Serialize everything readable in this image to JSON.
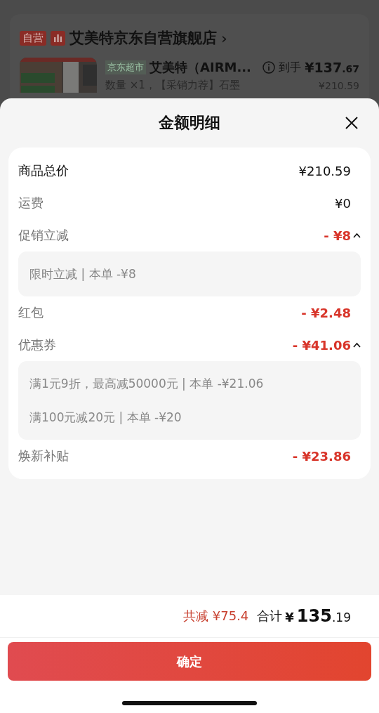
{
  "background_page": {
    "store": {
      "badge": "自营",
      "name": "艾美特京东自营旗舰店",
      "chevron": "›"
    },
    "product": {
      "channel_tag": "京东超市",
      "title": "艾美特（AIRM...",
      "price_label": "到手",
      "price_main": "¥137",
      "price_fraction": ".67",
      "spec": "数量 ×1，【采销力荐】石墨",
      "original_price": "¥210.59"
    }
  },
  "sheet": {
    "title": "金额明细",
    "rows": [
      {
        "kind": "total",
        "label": "商品总价",
        "value": "¥210.59"
      },
      {
        "kind": "plain",
        "label": "运费",
        "value": "¥0"
      },
      {
        "kind": "discount",
        "label": "促销立减",
        "value": "- ¥8",
        "expanded": true,
        "details": [
          "限时立减 | 本单 -¥8"
        ]
      },
      {
        "kind": "discount",
        "label": "红包",
        "value": "- ¥2.48"
      },
      {
        "kind": "discount",
        "label": "优惠券",
        "value": "- ¥41.06",
        "expanded": true,
        "details": [
          "满1元9折，最高减50000元 | 本单 -¥21.06",
          "满100元减20元 | 本单 -¥20"
        ]
      },
      {
        "kind": "discount",
        "label": "焕新补贴",
        "value": "- ¥23.86"
      }
    ],
    "summary": {
      "saved": "共减 ¥75.4",
      "total_label": "合计",
      "total_currency": "¥",
      "total_main": "135",
      "total_fraction": ".19"
    },
    "confirm_button": "确定"
  }
}
